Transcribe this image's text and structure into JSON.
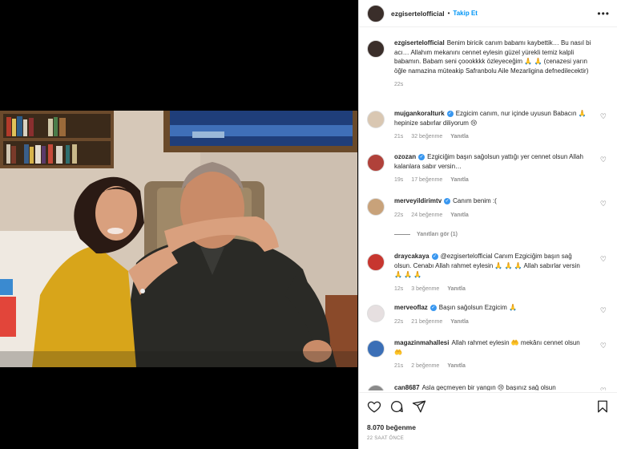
{
  "header": {
    "username": "ezgisertelofficial",
    "separator": "•",
    "follow_label": "Takip Et",
    "more": "•••"
  },
  "caption": {
    "username": "ezgisertelofficial",
    "text": "Benim biricik canım babamı kaybettik… Bu nasıl bi acı… Allahım mekanını cennet eylesin güzel yürekli temiz kalpli babamın. Babam seni çoookkkk özleyeceğim 🙏 🙏 (cenazesi yarın öğle namazina müteakip Safranbolu Aile Mezarligina defnedilecektir)",
    "time": "22s"
  },
  "comments": [
    {
      "username": "mujgankoralturk",
      "verified": true,
      "text": "Ezgicim canım, nur içinde uyusun Babacın 🙏 hepinize sabırlar diliyorum 😢",
      "time": "21s",
      "likes": "32 beğenme",
      "reply": "Yanıtla",
      "avatar_color": "#d9c7b2"
    },
    {
      "username": "ozozan",
      "verified": true,
      "text": "Ezgiciğim başın sağolsun yattığı yer cennet olsun Allah kalanlara sabır versin…",
      "time": "19s",
      "likes": "17 beğenme",
      "reply": "Yanıtla",
      "avatar_color": "#b0413a"
    },
    {
      "username": "merveyildirimtv",
      "verified": true,
      "text": "Canım benim :(",
      "time": "22s",
      "likes": "24 beğenme",
      "reply": "Yanıtla",
      "avatar_color": "#c8a27a"
    },
    {
      "username": "draycakaya",
      "verified": true,
      "text": "@ezgisertelofficial Canım Ezgiciğim başın sağ olsun. Cenabı Allah rahmet eylesin 🙏 🙏 🙏 Allah sabırlar versin 🙏 🙏 🙏",
      "time": "12s",
      "likes": "3 beğenme",
      "reply": "Yanıtla",
      "avatar_color": "#c7362f"
    },
    {
      "username": "merveoflaz",
      "verified": true,
      "text": "Başın sağolsun Ezgicim 🙏",
      "time": "22s",
      "likes": "21 beğenme",
      "reply": "Yanıtla",
      "avatar_color": "#e6dfe0"
    },
    {
      "username": "magazinmahallesi",
      "verified": false,
      "text": "Allah rahmet eylesin 🤲 mekânı cennet olsun 🤲",
      "time": "21s",
      "likes": "2 beğenme",
      "reply": "Yanıtla",
      "avatar_color": "#3b6fb6"
    },
    {
      "username": "can8687",
      "verified": false,
      "text": "Asla geçmeyen bir yangın 😢 başınız sağ olsun",
      "time": "",
      "likes": "",
      "reply": "",
      "avatar_color": "#8a8a8a"
    }
  ],
  "view_replies": "Yanıtları gör (1)",
  "footer": {
    "likes": "8.070 beğenme",
    "time_ago": "22 SAAT ÖNCE"
  },
  "icons": {
    "like": "heart-icon",
    "comment": "comment-icon",
    "share": "share-icon",
    "save": "bookmark-icon"
  }
}
